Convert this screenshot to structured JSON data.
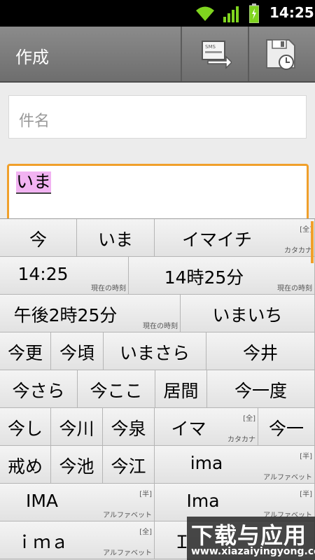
{
  "status_bar": {
    "time": "14:25",
    "icons": [
      "wifi-icon",
      "signal-icon",
      "battery-icon"
    ]
  },
  "action_bar": {
    "title": "作成",
    "buttons": [
      "send-icon",
      "save-icon"
    ]
  },
  "compose": {
    "subject_placeholder": "件名",
    "body_composing_text": "いま"
  },
  "candidates": {
    "rows": [
      [
        {
          "word": "今"
        },
        {
          "word": "いま"
        },
        {
          "word": "イマイチ",
          "note_top": "[全]",
          "note": "カタカナ"
        }
      ],
      [
        {
          "word": "14:25",
          "note": "現在の時刻"
        },
        {
          "word": "14時25分",
          "note": "現在の時刻"
        }
      ],
      [
        {
          "word": "午後2時25分",
          "note": "現在の時刻"
        },
        {
          "word": "いまいち"
        }
      ],
      [
        {
          "word": "今更"
        },
        {
          "word": "今頃"
        },
        {
          "word": "いまさら"
        },
        {
          "word": "今井"
        }
      ],
      [
        {
          "word": "今さら"
        },
        {
          "word": "今ここ"
        },
        {
          "word": "居間"
        },
        {
          "word": "今一度"
        }
      ],
      [
        {
          "word": "今し"
        },
        {
          "word": "今川"
        },
        {
          "word": "今泉"
        },
        {
          "word": "イマ",
          "note_top": "[全]",
          "note": "カタカナ"
        },
        {
          "word": "今一"
        }
      ],
      [
        {
          "word": "戒め"
        },
        {
          "word": "今池"
        },
        {
          "word": "今江"
        },
        {
          "word": "ima",
          "note_top": "[半]",
          "note": "アルファベット"
        }
      ],
      [
        {
          "word": "IMA",
          "note_top": "[半]",
          "note": "アルファベット"
        },
        {
          "word": "Ima",
          "note_top": "[半]",
          "note": "アルファベット"
        }
      ],
      [
        {
          "word": "ｉｍａ",
          "note_top": "[全]",
          "note": "アルファベット"
        },
        {
          "word": "Ｉ"
        }
      ]
    ]
  },
  "watermark": {
    "line1": "下载与应用",
    "line2": "www.xiazaiyingyong.com"
  },
  "colors": {
    "accent": "#f0a02b",
    "composing_highlight": "#f2b3f2"
  }
}
